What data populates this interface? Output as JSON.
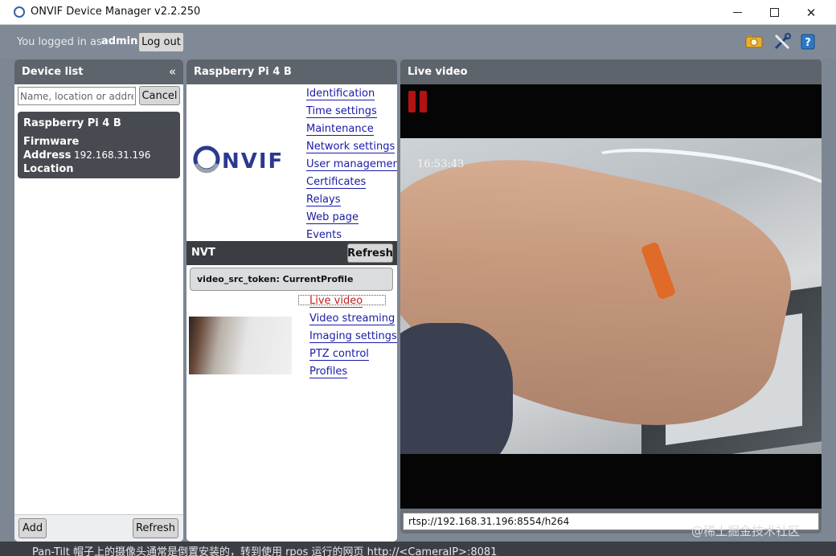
{
  "window": {
    "title": "ONVIF Device Manager v2.2.250",
    "minimize_icon": "minimize-icon",
    "maximize_icon": "maximize-icon",
    "close_icon": "close-icon"
  },
  "session": {
    "logged_in_text": "You logged in as",
    "username": "admin",
    "logout_label": "Log out"
  },
  "toolbar_icons": [
    "camera-settings-icon",
    "tools-icon",
    "help-icon"
  ],
  "device_list": {
    "header": "Device list",
    "collapse_glyph": "«",
    "search_placeholder": "Name, location or address",
    "cancel_label": "Cancel",
    "devices": [
      {
        "name": "Raspberry Pi 4 B",
        "firmware_label": "Firmware",
        "address_label": "Address",
        "address": "192.168.31.196",
        "location_label": "Location"
      }
    ],
    "add_label": "Add",
    "refresh_label": "Refresh"
  },
  "device_panel": {
    "header": "Raspberry Pi 4 B",
    "logo_text": "NVIF",
    "links": [
      "Identification",
      "Time settings",
      "Maintenance",
      "Network settings",
      "User management",
      "Certificates",
      "Relays",
      "Web page",
      "Events"
    ],
    "nvt_label": "NVT",
    "nvt_refresh_label": "Refresh",
    "profile_label": "video_src_token: CurrentProfile",
    "profile_links": [
      "Live video",
      "Video streaming",
      "Imaging settings",
      "PTZ control",
      "Profiles"
    ]
  },
  "live_panel": {
    "header": "Live video",
    "timestamp": "16:53:43",
    "stream_url": "rtsp://192.168.31.196:8554/h264"
  },
  "bottom_text": "Pan-Tilt 帽子上的摄像头通常是倒置安装的，转到使用 rpos 运行的网页 http://<CameraIP>:8081",
  "watermark": "@稀土掘金技术社区",
  "colors": {
    "accent_link": "#1a1aa8",
    "active_link": "#c02020",
    "panel_header": "#5e646c",
    "pause": "#b31212"
  }
}
